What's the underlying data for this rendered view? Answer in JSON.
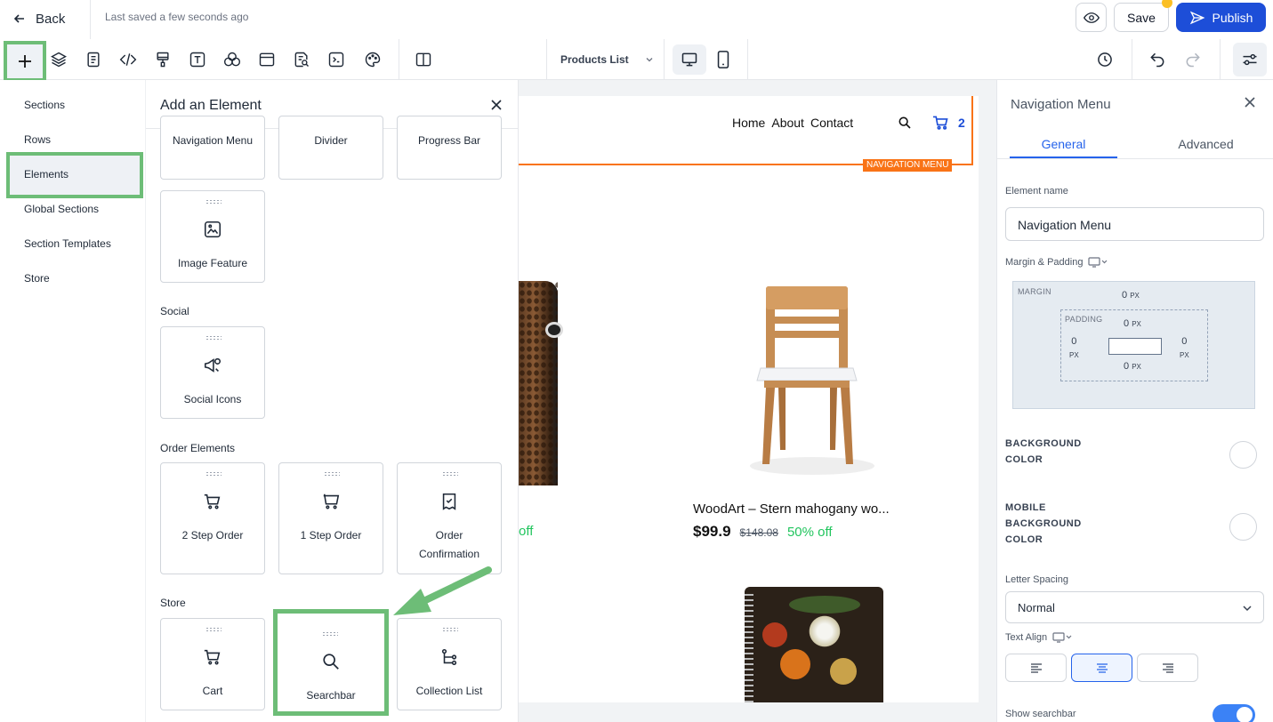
{
  "topbar": {
    "back_label": "Back",
    "last_saved": "Last saved a few seconds ago",
    "save_label": "Save",
    "publish_label": "Publish"
  },
  "toolbar": {
    "page_select": "Products List",
    "icons": [
      "add-icon",
      "layers-icon",
      "page-icon",
      "code-icon",
      "paint-icon",
      "text-icon",
      "shapes-icon",
      "layout-icon",
      "seo-icon",
      "terminal-icon",
      "palette-icon",
      "columns-icon"
    ]
  },
  "leftnav": {
    "items": [
      "Sections",
      "Rows",
      "Elements",
      "Global Sections",
      "Section Templates",
      "Store"
    ],
    "active": "Elements"
  },
  "panel": {
    "title": "Add an Element",
    "top_cards": [
      "Navigation Menu",
      "Divider",
      "Progress Bar"
    ],
    "image_feature": "Image Feature",
    "groups": {
      "social": {
        "title": "Social",
        "cards": [
          "Social Icons"
        ]
      },
      "order": {
        "title": "Order Elements",
        "cards": [
          "2 Step Order",
          "1 Step Order",
          "Order Confirmation"
        ]
      },
      "store": {
        "title": "Store",
        "cards": [
          "Cart",
          "Searchbar",
          "Collection List"
        ]
      }
    }
  },
  "canvas": {
    "links": [
      "Home",
      "About",
      "Contact"
    ],
    "cart_count": "2",
    "nav_tag": "NAVIGATION MENU",
    "product": {
      "title": "WoodArt – Stern mahogany wo...",
      "price": "$99.9",
      "was": "$148.08",
      "off": "50% off"
    },
    "left_off": "off"
  },
  "rpanel": {
    "title": "Navigation Menu",
    "tab_general": "General",
    "tab_advanced": "Advanced",
    "element_name_label": "Element name",
    "element_name_value": "Navigation Menu",
    "margin_padding_label": "Margin & Padding",
    "margin_label": "MARGIN",
    "padding_label": "PADDING",
    "zero": "0",
    "unit": "PX",
    "bg_color_label": "BACKGROUND COLOR",
    "mobile_bg_label_1": "MOBILE",
    "mobile_bg_label_2": "BACKGROUND",
    "mobile_bg_label_3": "COLOR",
    "bg_label_1": "BACKGROUND",
    "bg_label_2": "COLOR",
    "letter_spacing_label": "Letter Spacing",
    "letter_spacing_value": "Normal",
    "text_align_label": "Text Align",
    "show_searchbar_label": "Show searchbar",
    "show_searchbar_value": true
  }
}
